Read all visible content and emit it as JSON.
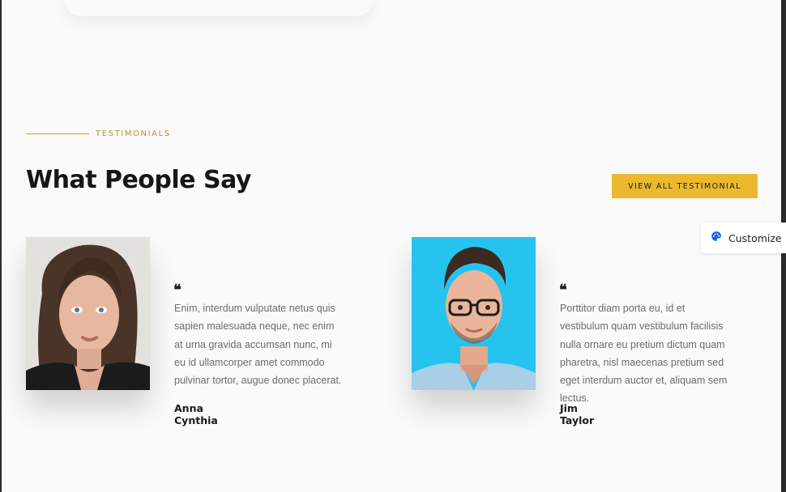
{
  "section": {
    "eyebrow": "TESTIMONIALS",
    "title": "What People Say",
    "cta_label": "VIEW ALL TESTIMONIAL"
  },
  "customize": {
    "label": "Customize",
    "icon": "palette-icon"
  },
  "testimonials": [
    {
      "quote_mark": "❝",
      "text": "Enim, interdum vulputate netus quis sapien malesuada neque, nec enim at urna gravida accumsan nunc, mi eu id ullamcorper amet commodo pulvinar tortor, augue donec placerat.",
      "author": "Anna Cynthia"
    },
    {
      "quote_mark": "❝",
      "text": "Porttitor diam porta eu, id et vestibulum quam vestibulum facilisis nulla ornare eu pretium dictum quam pharetra, nisl maecenas pretium sed eget interdum auctor et, aliquam sem lectus.",
      "author": "Jim Taylor"
    }
  ],
  "colors": {
    "accent": "#ebb92f",
    "eyebrow": "#b8952e",
    "background": "#fafafa",
    "text_muted": "#6b6b6b"
  }
}
